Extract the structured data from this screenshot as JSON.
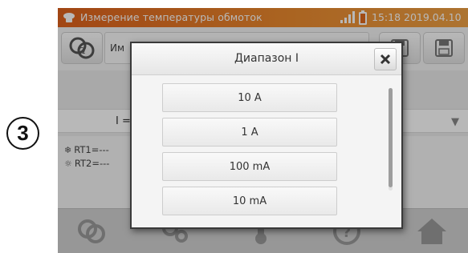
{
  "step_marker": "3",
  "statusbar": {
    "title": "Измерение температуры обмоток",
    "time": "15:18 2019.04.10",
    "icons": [
      "meter-logo-icon",
      "signal-icon",
      "battery-icon"
    ]
  },
  "toolbar": {
    "name_value": "Им",
    "icons": [
      "resistance-icon",
      "save-icon",
      "save-as-icon"
    ]
  },
  "settings": {
    "range_label": "I ="
  },
  "results": {
    "rt1_label": "RT1=---",
    "rt2_label": "RT2=---",
    "rt1_icon": "cold-icon",
    "rt2_icon": "hot-icon"
  },
  "bottom_nav": [
    "measurement-icon",
    "settings-icon",
    "temperature-icon",
    "help-icon",
    "home-icon"
  ],
  "dialog": {
    "title": "Диапазон I",
    "options": [
      "10 A",
      "1 A",
      "100 mA",
      "10 mA"
    ],
    "close_icon": "close-icon"
  },
  "colors": {
    "statusbar_start": "#e0621c",
    "statusbar_end": "#f0a144",
    "battery": "#ffffff",
    "overlay_dim": "rgba(0,0,0,0.28)"
  }
}
